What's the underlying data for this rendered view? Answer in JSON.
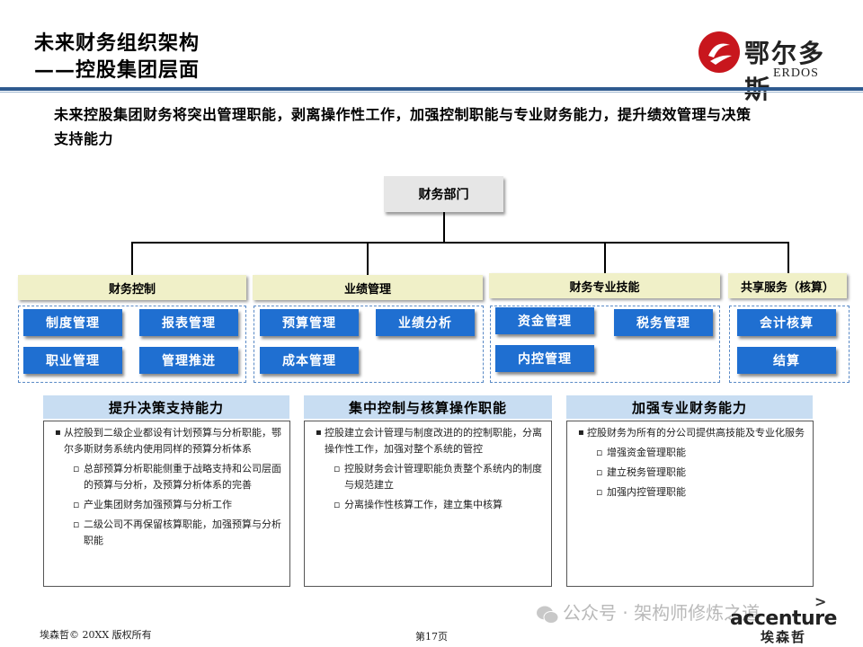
{
  "header": {
    "title_line1": "未来财务组织架构",
    "title_line2": "——控股集团层面"
  },
  "logo": {
    "cn": "鄂尔多斯",
    "en": "ERDOS",
    "icon": "erdos-logo-icon",
    "color": "#c8161d"
  },
  "intro": "未来控股集团财务将突出管理职能，剥离操作性工作，加强控制职能与专业财务能力，提升绩效管理与决策支持能力",
  "org": {
    "root": "财务部门",
    "categories": [
      {
        "label": "财务控制",
        "items": [
          "制度管理",
          "报表管理",
          "职业管理",
          "管理推进"
        ]
      },
      {
        "label": "业绩管理",
        "items": [
          "预算管理",
          "业绩分析",
          "成本管理"
        ]
      },
      {
        "label": "财务专业技能",
        "items": [
          "资金管理",
          "税务管理",
          "内控管理"
        ]
      },
      {
        "label": "共享服务（核算）",
        "items": [
          "会计核算",
          "结算"
        ]
      }
    ]
  },
  "panels": [
    {
      "header": "提升决策支持能力",
      "bullet": "从控股到二级企业都设有计划预算与分析职能，鄂尔多斯财务系统内使用同样的预算分析体系",
      "subs": [
        "总部预算分析职能侧重于战略支持和公司层面的预算与分析，及预算分析体系的完善",
        "产业集团财务加强预算与分析工作",
        "二级公司不再保留核算职能，加强预算与分析职能"
      ]
    },
    {
      "header": "集中控制与核算操作职能",
      "bullet": "控股建立会计管理与制度改进的的控制职能，分离操作性工作，加强对整个系统的管控",
      "subs": [
        "控股财务会计管理职能负责整个系统内的制度与规范建立",
        "分离操作性核算工作，建立集中核算"
      ]
    },
    {
      "header": "加强专业财务能力",
      "bullet": "控股财务为所有的分公司提供高技能及专业化服务",
      "subs": [
        "增强资金管理职能",
        "建立税务管理职能",
        "加强内控管理职能"
      ]
    }
  ],
  "footer": {
    "copyright": "埃森哲©  20XX 版权所有",
    "page": "第17页",
    "watermark": "公众号 · 架构师修炼之道",
    "brand": "accenture",
    "brand_cn": "埃森哲"
  },
  "colors": {
    "rule": "#2e5a8f",
    "button": "#1f6fd1",
    "category_bg": "#f0f0c8",
    "panel_header_bg": "#c8ddf2"
  }
}
